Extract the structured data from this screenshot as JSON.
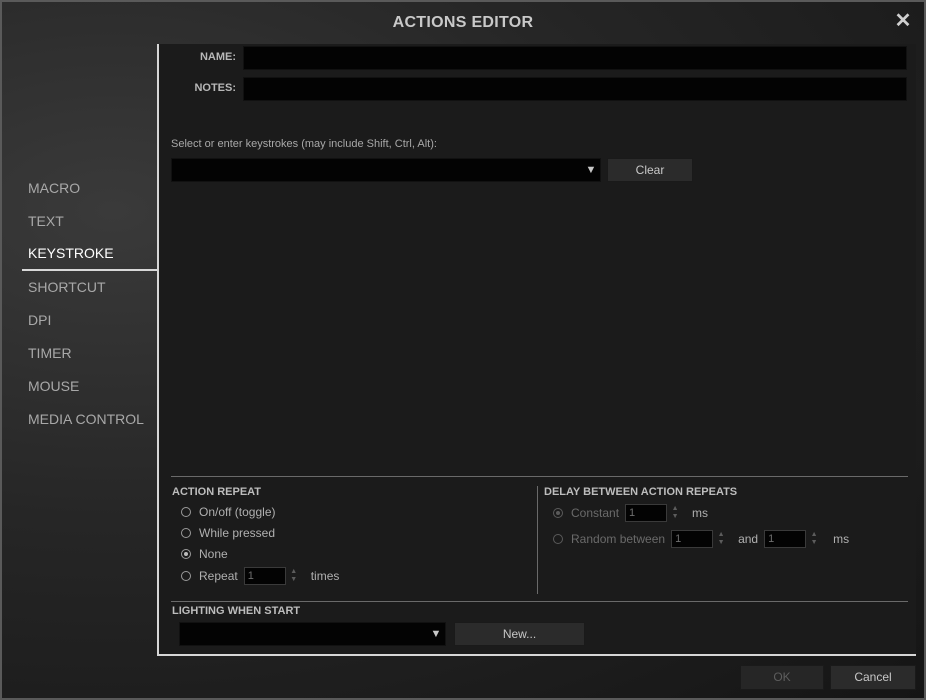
{
  "window": {
    "title": "ACTIONS EDITOR",
    "close_icon": "close-icon"
  },
  "nav": {
    "items": [
      {
        "label": "MACRO"
      },
      {
        "label": "TEXT"
      },
      {
        "label": "KEYSTROKE",
        "active": true
      },
      {
        "label": "SHORTCUT"
      },
      {
        "label": "DPI"
      },
      {
        "label": "TIMER"
      },
      {
        "label": "MOUSE"
      },
      {
        "label": "MEDIA CONTROL"
      }
    ]
  },
  "form": {
    "name_label": "NAME:",
    "name_value": "",
    "notes_label": "NOTES:",
    "notes_value": ""
  },
  "keystroke": {
    "prompt": "Select or enter keystrokes (may include Shift, Ctrl, Alt):",
    "selected": "",
    "clear_label": "Clear"
  },
  "action_repeat": {
    "title": "ACTION REPEAT",
    "options": [
      {
        "label": "On/off (toggle)",
        "checked": false
      },
      {
        "label": "While pressed",
        "checked": false
      },
      {
        "label": "None",
        "checked": true
      },
      {
        "label": "Repeat",
        "checked": false
      }
    ],
    "repeat_value": "1",
    "repeat_unit": "times"
  },
  "delay": {
    "title": "DELAY BETWEEN ACTION REPEATS",
    "constant_label": "Constant",
    "constant_value": "1",
    "constant_unit": "ms",
    "random_label": "Random between",
    "random_min": "1",
    "random_and": "and",
    "random_max": "1",
    "random_unit": "ms"
  },
  "lighting": {
    "title": "LIGHTING WHEN START",
    "selected": "",
    "new_label": "New..."
  },
  "footer": {
    "ok_label": "OK",
    "cancel_label": "Cancel"
  }
}
